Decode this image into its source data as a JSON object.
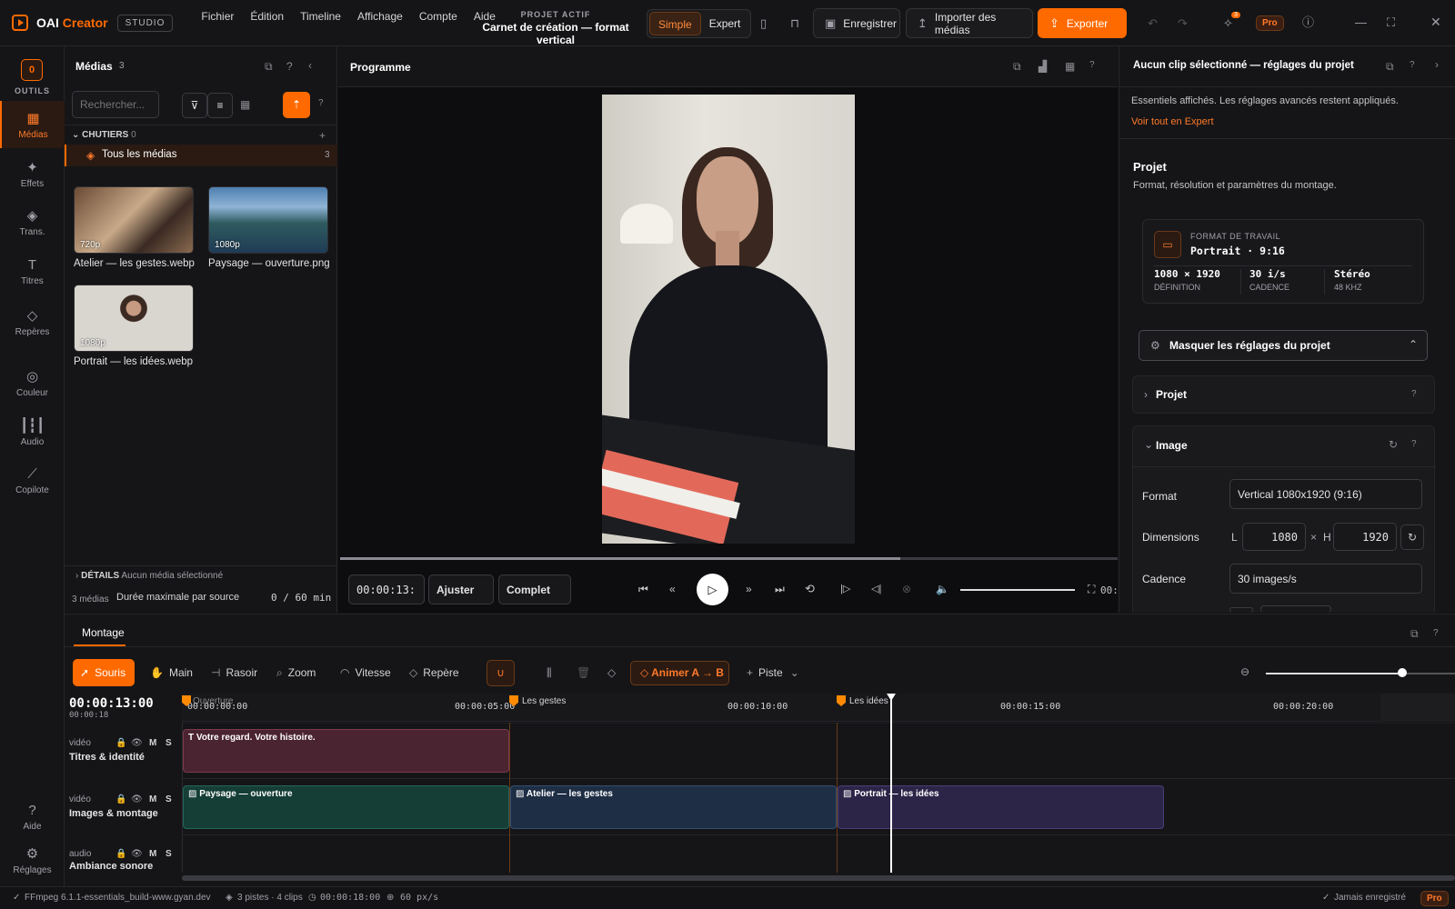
{
  "app": {
    "brand_main": "OAI",
    "brand_accent": "Creator",
    "badge": "STUDIO",
    "accent_color": "#ff6a00"
  },
  "menu": [
    "Fichier",
    "Édition",
    "Timeline",
    "Affichage",
    "Compte",
    "Aide"
  ],
  "project": {
    "label": "PROJET ACTIF",
    "name": "Carnet de création — format vertical"
  },
  "mode": {
    "simple": "Simple",
    "expert": "Expert",
    "selected": "Simple"
  },
  "toolbar": {
    "save": "Enregistrer",
    "import": "Importer des médias",
    "export": "Exporter",
    "notif_count": "3",
    "pro": "Pro"
  },
  "nav": {
    "tools_label": "OUTILS",
    "tools_icon": "0",
    "items": [
      {
        "label": "Médias",
        "icon": "film-icon"
      },
      {
        "label": "Effets",
        "icon": "sparkle-icon"
      },
      {
        "label": "Trans.",
        "icon": "layers-icon"
      },
      {
        "label": "Titres",
        "icon": "text-icon"
      },
      {
        "label": "Repères",
        "icon": "diamond-icon"
      },
      {
        "label": "Couleur",
        "icon": "palette-icon"
      },
      {
        "label": "Audio",
        "icon": "waveform-icon"
      },
      {
        "label": "Copilote",
        "icon": "wand-icon"
      }
    ],
    "help": "Aide",
    "settings": "Réglages"
  },
  "media": {
    "title": "Médias",
    "count": "3",
    "search_placeholder": "Rechercher...",
    "bins_label": "CHUTIERS",
    "bins_count": "0",
    "all_media": "Tous les médias",
    "all_media_count": "3",
    "items": [
      {
        "name": "Atelier — les gestes.webp",
        "res": "720p"
      },
      {
        "name": "Paysage — ouverture.png",
        "res": "1080p"
      },
      {
        "name": "Portrait — les idées.webp",
        "res": "1080p"
      }
    ],
    "details_label": "DÉTAILS",
    "details_value": "Aucun média sélectionné",
    "footer_count": "3 médias",
    "footer_label": "Durée maximale par source",
    "footer_value": "0 / 60 min"
  },
  "program": {
    "title": "Programme",
    "timecode": "00:00:13:",
    "fit": "Ajuster",
    "quality": "Complet",
    "end_time": "00:",
    "progress": 0.72,
    "volume": 1.0
  },
  "inspector": {
    "title": "Aucun clip sélectionné — réglages du projet",
    "note": "Essentiels affichés. Les réglages avancés restent appliqués.",
    "link": "Voir tout en Expert",
    "section_title": "Projet",
    "section_sub": "Format, résolution et paramètres du montage.",
    "format_label": "FORMAT DE TRAVAIL",
    "format_value": "Portrait · 9:16",
    "stats": [
      {
        "v": "1080 × 1920",
        "l": "DÉFINITION"
      },
      {
        "v": "30 i/s",
        "l": "CADENCE"
      },
      {
        "v": "Stéréo",
        "l": "48 KHZ"
      }
    ],
    "hide_button": "Masquer les réglages du projet",
    "acc_project": "Projet",
    "acc_image": "Image",
    "format_row": "Format",
    "format_field": "Vertical 1080x1920 (9:16)",
    "dim_row": "Dimensions",
    "w_label": "L",
    "w_value": "1080",
    "x": "×",
    "h_label": "H",
    "h_value": "1920",
    "rate_row": "Cadence",
    "rate_field": "30 images/s"
  },
  "timeline": {
    "tab": "Montage",
    "tools": [
      "Souris",
      "Main",
      "Rasoir",
      "Zoom",
      "Vitesse",
      "Repère"
    ],
    "animate": "Animer A → B",
    "track": "Piste",
    "timecode": "00:00:13:00",
    "duration": "00:00:18",
    "zoom": 0.75,
    "ticks": [
      "00:00:00:00",
      "00:00:05:00",
      "00:00:10:00",
      "00:00:15:00",
      "00:00:20:00"
    ],
    "markers": [
      "Ouverture",
      "Les gestes",
      "Les idées"
    ],
    "tracks": [
      {
        "type": "vidéo",
        "name": "Titres & identité"
      },
      {
        "type": "vidéo",
        "name": "Images & montage"
      },
      {
        "type": "audio",
        "name": "Ambiance sonore"
      }
    ],
    "track_flags": [
      "M",
      "S"
    ],
    "clips": [
      {
        "label": "Votre regard. Votre histoire.",
        "color": "#4a2430"
      },
      {
        "label": "Paysage — ouverture",
        "color": "#153e36"
      },
      {
        "label": "Atelier — les gestes",
        "color": "#1e2e45"
      },
      {
        "label": "Portrait — les idées",
        "color": "#2c2548"
      }
    ]
  },
  "status": {
    "ffmpeg": "FFmpeg 6.1.1-essentials_build-www.gyan.dev",
    "tracks": "3 pistes · 4 clips",
    "duration": "00:00:18:00",
    "zoom": "60 px/s",
    "saved": "Jamais enregistré",
    "pro": "Pro"
  }
}
